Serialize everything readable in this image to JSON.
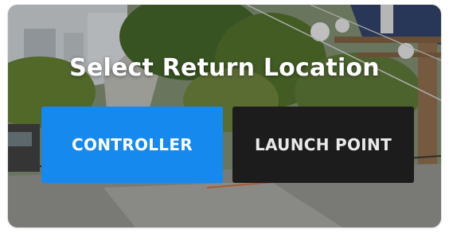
{
  "dialog": {
    "title": "Select Return Location"
  },
  "options": {
    "controller_label": "CONTROLLER",
    "launch_point_label": "LAUNCH POINT",
    "selected": "CONTROLLER"
  },
  "colors": {
    "accent": "#1589ee",
    "secondary_button": "#1c1c1c",
    "text": "#ffffff"
  }
}
